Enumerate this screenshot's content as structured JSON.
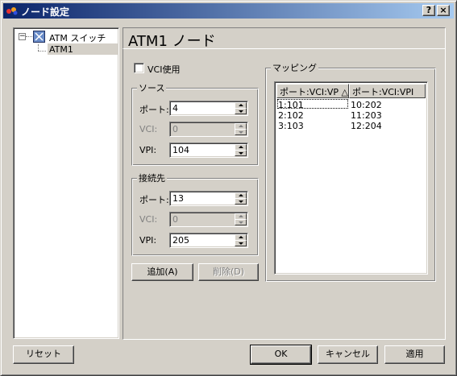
{
  "window": {
    "title": "ノード設定",
    "help_button": "?",
    "close_button": "×"
  },
  "tree": {
    "root_label": "ATM スイッチ",
    "expander": "−",
    "child_label": "ATM1"
  },
  "panel": {
    "header": "ATM1 ノード",
    "vci_checkbox_label": "VCI使用",
    "vci_checked": false
  },
  "source": {
    "legend": "ソース",
    "port_label": "ポート:",
    "port_value": "4",
    "vci_label": "VCI:",
    "vci_value": "0",
    "vpi_label": "VPI:",
    "vpi_value": "104"
  },
  "destination": {
    "legend": "接続先",
    "port_label": "ポート:",
    "port_value": "13",
    "vci_label": "VCI:",
    "vci_value": "0",
    "vpi_label": "VPI:",
    "vpi_value": "205"
  },
  "actions": {
    "add": "追加(A)",
    "delete": "削除(D)"
  },
  "mapping": {
    "legend": "マッピング",
    "columns": [
      "ポート:VCI:VP △",
      "ポート:VCI:VPI"
    ],
    "rows": [
      [
        "1:101",
        "10:202"
      ],
      [
        "2:102",
        "11:203"
      ],
      [
        "3:103",
        "12:204"
      ]
    ]
  },
  "footer": {
    "reset": "リセット",
    "ok": "OK",
    "cancel": "キャンセル",
    "apply": "適用"
  },
  "colors": {
    "face": "#d4d0c8",
    "title_start": "#0a246a",
    "title_end": "#a6caf0",
    "disabled_text": "#808080"
  }
}
